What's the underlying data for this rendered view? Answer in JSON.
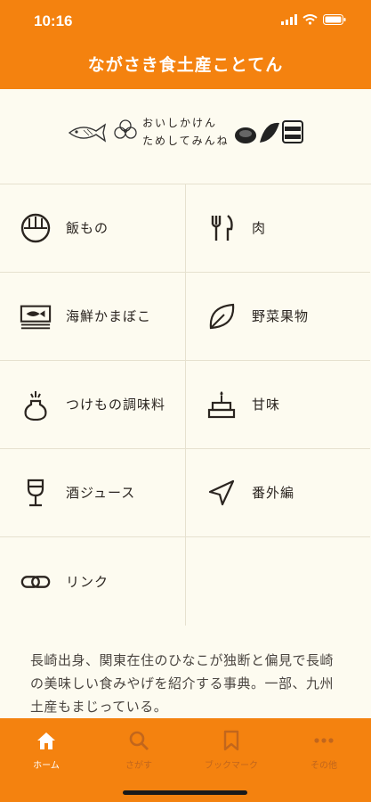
{
  "status": {
    "time": "10:16"
  },
  "header": {
    "title": "ながさき食土産ことてん"
  },
  "banner": {
    "line1": "おいしかけん",
    "line2": "ためしてみんね"
  },
  "categories": [
    {
      "label": "飯もの",
      "icon": "rice-bowl-icon"
    },
    {
      "label": "肉",
      "icon": "fork-knife-icon"
    },
    {
      "label": "海鮮かまぼこ",
      "icon": "fish-icon"
    },
    {
      "label": "野菜果物",
      "icon": "leaf-icon"
    },
    {
      "label": "つけもの調味料",
      "icon": "condiment-jar-icon"
    },
    {
      "label": "甘味",
      "icon": "cake-icon"
    },
    {
      "label": "酒ジュース",
      "icon": "wine-glass-icon"
    },
    {
      "label": "番外編",
      "icon": "navigation-arrow-icon"
    },
    {
      "label": "リンク",
      "icon": "link-icon"
    }
  ],
  "description": "長崎出身、関東在住のひなこが独断と偏見で長崎の美味しい食みやげを紹介する事典。一部、九州土産もまじっている。",
  "tabs": [
    {
      "label": "ホーム",
      "icon": "home-icon",
      "active": true
    },
    {
      "label": "さがす",
      "icon": "search-icon",
      "active": false
    },
    {
      "label": "ブックマーク",
      "icon": "bookmark-icon",
      "active": false
    },
    {
      "label": "その他",
      "icon": "more-icon",
      "active": false
    }
  ],
  "colors": {
    "accent": "#f4820f",
    "background": "#fdfbf0",
    "text": "#2b2520"
  }
}
